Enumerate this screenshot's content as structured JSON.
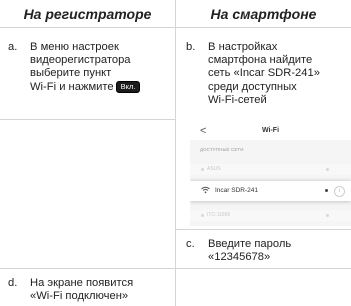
{
  "headers": {
    "left": "На регистраторе",
    "right": "На смартфоне"
  },
  "steps": {
    "a": {
      "letter": "a.",
      "lines": [
        "В меню настроек",
        "видеорегистратора",
        "выберите пункт",
        "Wi-Fi и нажмите"
      ],
      "button": "Вкл."
    },
    "b": {
      "letter": "b.",
      "lines": [
        "В настройках",
        "смартфона найдите",
        "сеть «Incar SDR-241»",
        "среди доступных",
        "Wi-Fi-сетей"
      ]
    },
    "c": {
      "letter": "c.",
      "lines": [
        "Введите пароль",
        "«12345678»"
      ]
    },
    "d": {
      "letter": "d.",
      "lines": [
        "На экране появится",
        "«Wi-Fi подключен»"
      ]
    }
  },
  "phone": {
    "back": "<",
    "title": "Wi-Fi",
    "section": "ДОСТУПНЫЕ СЕТИ",
    "networks": [
      "ASUS",
      "Incar SDR-241",
      "ITC-11865"
    ],
    "info": "i",
    "icons": {
      "wifi": "wifi-icon",
      "lock": "lock-icon",
      "info": "info-icon",
      "back": "back-chevron-icon"
    }
  }
}
